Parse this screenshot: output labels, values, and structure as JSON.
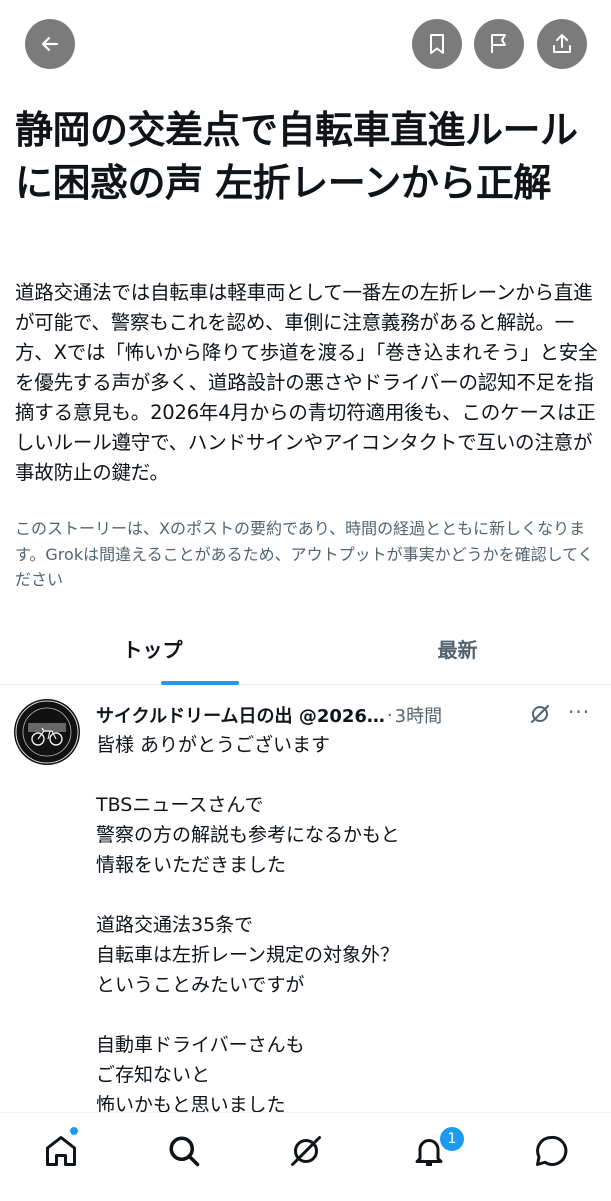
{
  "header": {
    "back_icon": "arrow-left-icon",
    "bookmark_icon": "bookmark-icon",
    "report_icon": "flag-icon",
    "share_icon": "share-icon",
    "button_bg": "#7b7b7b"
  },
  "story": {
    "title": "静岡の交差点で自転車直進ルールに困惑の声 左折レーンから正解",
    "summary": "道路交通法では自転車は軽車両として一番左の左折レーンから直進が可能で、警察もこれを認め、車側に注意義務があると解説。一方、Xでは「怖いから降りて歩道を渡る」「巻き込まれそう」と安全を優先する声が多く、道路設計の悪さやドライバーの認知不足を指摘する意見も。2026年4月からの青切符適用後も、このケースは正しいルール遵守で、ハンドサインやアイコンタクトで互いの注意が事故防止の鍵だ。",
    "disclaimer": "このストーリーは、Xのポストの要約であり、時間の経過とともに新しくなります。Grokは間違えることがあるため、アウトプットが事実かどうかを確認してください"
  },
  "tabs": [
    {
      "label": "トップ",
      "active": true
    },
    {
      "label": "最新",
      "active": false
    }
  ],
  "post": {
    "author": "サイクルドリーム日の出 @2026…",
    "separator": "·",
    "time": "3時間",
    "more_label": "···",
    "lines": [
      "皆様 ありがとうございます",
      "",
      "TBSニュースさんで",
      "警察の方の解説も参考になるかもと",
      "情報をいただきました",
      "",
      "道路交通法35条で",
      "自転車は左折レーン規定の対象外？",
      "ということみたいですが",
      "",
      "自動車ドライバーさんも",
      "ご存知ないと",
      "怖いかもと思いました"
    ]
  },
  "bottom_nav": {
    "items": [
      "home-icon",
      "search-icon",
      "grok-icon",
      "notifications-icon",
      "messages-icon"
    ],
    "notification_count": "1",
    "accent": "#1d9bf0"
  }
}
